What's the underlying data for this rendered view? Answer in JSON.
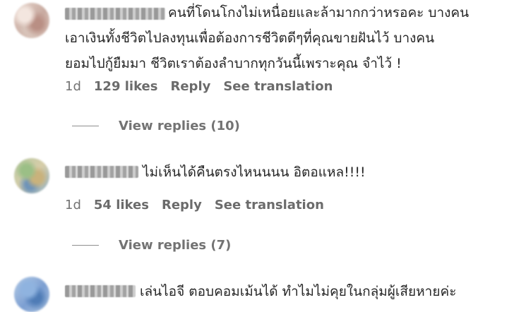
{
  "comments": [
    {
      "text_lines": [
        "คนที่โดนโกงไม่เหนื่อยและล้ามากกว่าหรอคะ บางคน",
        "เอาเงินทั้งชีวิตไปลงทุนเพื่อต้องการชีวิตดีๆที่คุณขายฝันไว้ บางคน",
        "ยอมไปกู้ยืมมา ชีวิตเราต้องลำบากทุกวันนี้เพราะคุณ จำไว้ !"
      ],
      "age": "1d",
      "likes": "129 likes",
      "reply": "Reply",
      "translate": "See translation",
      "view_replies": "View replies (10)"
    },
    {
      "text_lines": [
        "ไม่เห็นได้คืนตรงไหนนนน อิตอแหล!!!!"
      ],
      "age": "1d",
      "likes": "54 likes",
      "reply": "Reply",
      "translate": "See translation",
      "view_replies": "View replies (7)"
    },
    {
      "text_lines": [
        "เล่นไอจี ตอบคอมเม้นได้ ทำไมไม่คุยในกลุ่มผู้เสียหายค่ะ"
      ]
    }
  ]
}
